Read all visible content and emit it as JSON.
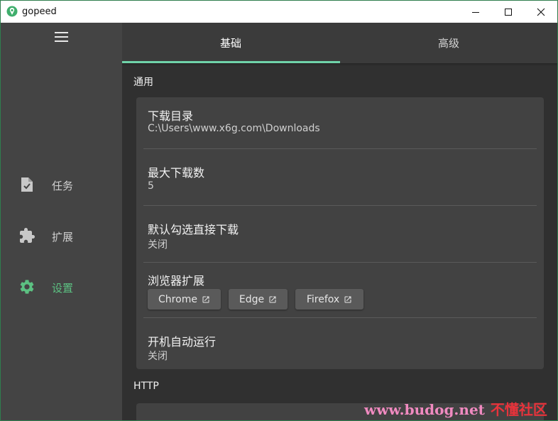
{
  "window": {
    "title": "gopeed",
    "controls": [
      "minimize",
      "maximize",
      "close"
    ]
  },
  "sidebar": {
    "menu_icon": "hamburger-menu-icon",
    "items": [
      {
        "label": "任务",
        "icon": "task-file-icon",
        "active": false
      },
      {
        "label": "扩展",
        "icon": "puzzle-piece-icon",
        "active": false
      },
      {
        "label": "设置",
        "icon": "gear-icon",
        "active": true
      }
    ]
  },
  "tabs": [
    {
      "label": "基础",
      "active": true
    },
    {
      "label": "高级",
      "active": false
    }
  ],
  "sections": {
    "general": "通用",
    "http": "HTTP"
  },
  "settings": {
    "download_dir": {
      "title": "下载目录",
      "value": "C:\\Users\\www.x6g.com\\Downloads"
    },
    "max_downloads": {
      "title": "最大下载数",
      "value": "5"
    },
    "auto_select": {
      "title": "默认勾选直接下载",
      "value": "关闭"
    },
    "browser_ext": {
      "title": "浏览器扩展",
      "buttons": [
        "Chrome",
        "Edge",
        "Firefox"
      ],
      "button_icon": "open-in-new-icon"
    },
    "autostart": {
      "title": "开机自动运行",
      "value": "关闭"
    }
  },
  "watermark": {
    "url": "www.budog.net",
    "text": "不懂社区"
  },
  "colors": {
    "accent": "#5cc182",
    "tab_indicator": "#6fd3a9",
    "sidebar_bg": "#444444",
    "main_bg": "#303030",
    "card_bg": "#424242"
  }
}
